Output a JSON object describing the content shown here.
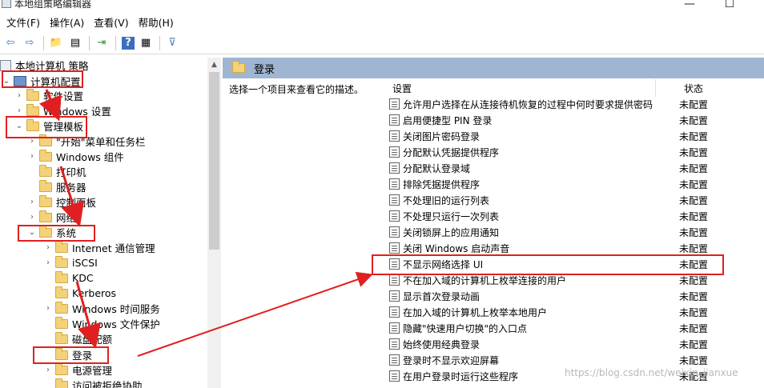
{
  "window": {
    "title": "本地组策略编辑器",
    "minimize_glyph": "—",
    "maximize_glyph": "☐"
  },
  "menu": [
    "文件(F)",
    "操作(A)",
    "查看(V)",
    "帮助(H)"
  ],
  "toolbar": {
    "back_glyph": "⇦",
    "forward_glyph": "⇨",
    "up_glyph": "📁",
    "showhide_glyph": "▤",
    "export_glyph": "⇥",
    "help_glyph": "?",
    "view_glyph": "▦",
    "filter_glyph": "⊽"
  },
  "tree": {
    "root": "本地计算机 策略",
    "computer_config": "计算机配置",
    "software_settings": "软件设置",
    "windows_settings": "Windows 设置",
    "admin_templates": "管理模板",
    "start_menu": "\"开始\"菜单和任务栏",
    "windows_components": "Windows 组件",
    "printers": "打印机",
    "server": "服务器",
    "control_panel": "控制面板",
    "network": "网络",
    "system": "系统",
    "internet_comm": "Internet 通信管理",
    "iscsi": "iSCSI",
    "kdc": "KDC",
    "kerberos": "Kerberos",
    "time_service": "Windows 时间服务",
    "file_protection": "Windows 文件保护",
    "disk_quota": "磁盘配额",
    "logon": "登录",
    "power": "电源管理",
    "access_denied": "访问被拒绝协助"
  },
  "right": {
    "header": "登录",
    "description": "选择一个项目来查看它的描述。",
    "col_setting": "设置",
    "col_state": "状态",
    "settings": [
      {
        "name": "允许用户选择在从连接待机恢复的过程中何时要求提供密码",
        "state": "未配置"
      },
      {
        "name": "启用便捷型 PIN 登录",
        "state": "未配置"
      },
      {
        "name": "关闭图片密码登录",
        "state": "未配置"
      },
      {
        "name": "分配默认凭据提供程序",
        "state": "未配置"
      },
      {
        "name": "分配默认登录域",
        "state": "未配置"
      },
      {
        "name": "排除凭据提供程序",
        "state": "未配置"
      },
      {
        "name": "不处理旧的运行列表",
        "state": "未配置"
      },
      {
        "name": "不处理只运行一次列表",
        "state": "未配置"
      },
      {
        "name": "关闭锁屏上的应用通知",
        "state": "未配置"
      },
      {
        "name": "关闭 Windows 启动声音",
        "state": "未配置"
      },
      {
        "name": "不显示网络选择 UI",
        "state": "未配置"
      },
      {
        "name": "不在加入域的计算机上枚举连接的用户",
        "state": "未配置"
      },
      {
        "name": "显示首次登录动画",
        "state": "未配置"
      },
      {
        "name": "在加入域的计算机上枚举本地用户",
        "state": "未配置"
      },
      {
        "name": "隐藏\"快速用户切换\"的入口点",
        "state": "未配置"
      },
      {
        "name": "始终使用经典登录",
        "state": "未配置"
      },
      {
        "name": "登录时不显示欢迎屏幕",
        "state": "未配置"
      },
      {
        "name": "在用户登录时运行这些程序",
        "state": "未配置"
      }
    ]
  },
  "watermark": "https://blog.csdn.net/weixin_jianxue",
  "colors": {
    "annotation": "#e02020",
    "header_bg": "#9fb5d1"
  }
}
